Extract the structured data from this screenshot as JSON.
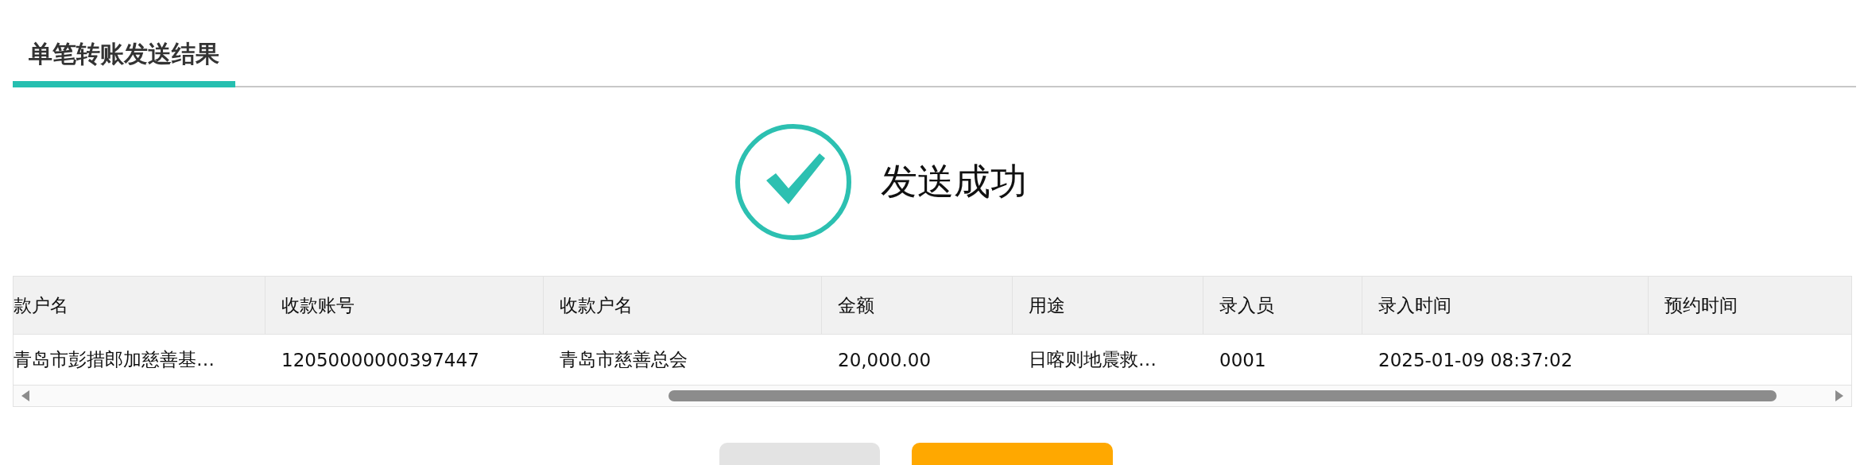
{
  "title": "单笔转账发送结果",
  "status": {
    "message": "发送成功"
  },
  "table": {
    "columns": [
      "款户名",
      "收款账号",
      "收款户名",
      "金额",
      "用途",
      "录入员",
      "录入时间",
      "预约时间"
    ],
    "rows": [
      {
        "cells": [
          "青岛市彭措郎加慈善基…",
          "12050000000397447",
          "青岛市慈善总会",
          "20,000.00",
          "日喀则地震救…",
          "0001",
          "2025-01-09 08:37:02"
        ]
      }
    ]
  },
  "buttons": [
    {
      "kind": "secondary"
    },
    {
      "kind": "primary"
    }
  ]
}
